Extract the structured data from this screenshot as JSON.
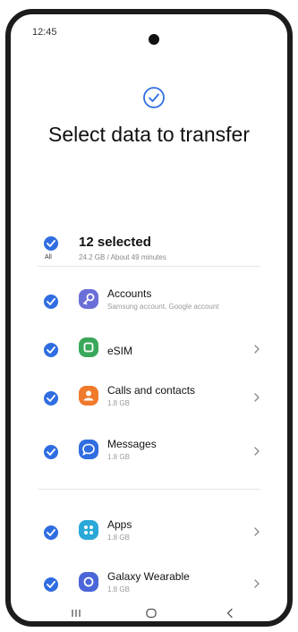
{
  "status": {
    "time": "12:45"
  },
  "header": {
    "title": "Select data to transfer"
  },
  "summary": {
    "all_label": "All",
    "count": "12 selected",
    "detail": "24.2 GB / About 49 minutes"
  },
  "items": [
    {
      "label": "Accounts",
      "sub": "Samsung account, Google account",
      "icon": "key-icon",
      "color": "#6a6fd8",
      "chevron": false
    },
    {
      "label": "eSIM",
      "sub": "",
      "icon": "sim-icon",
      "color": "#3aa85a",
      "chevron": true
    },
    {
      "label": "Calls and contacts",
      "sub": "1.8 GB",
      "icon": "contact-icon",
      "color": "#f07a2c",
      "chevron": true
    },
    {
      "label": "Messages",
      "sub": "1.8 GB",
      "icon": "message-icon",
      "color": "#2f6de1",
      "chevron": true
    },
    {
      "label": "Apps",
      "sub": "1.8 GB",
      "icon": "apps-icon",
      "color": "#2aa8d8",
      "chevron": true
    },
    {
      "label": "Galaxy Wearable",
      "sub": "1.8 GB",
      "icon": "watch-icon",
      "color": "#4a66d8",
      "chevron": true
    }
  ],
  "colors": {
    "accent": "#2f6de1"
  }
}
